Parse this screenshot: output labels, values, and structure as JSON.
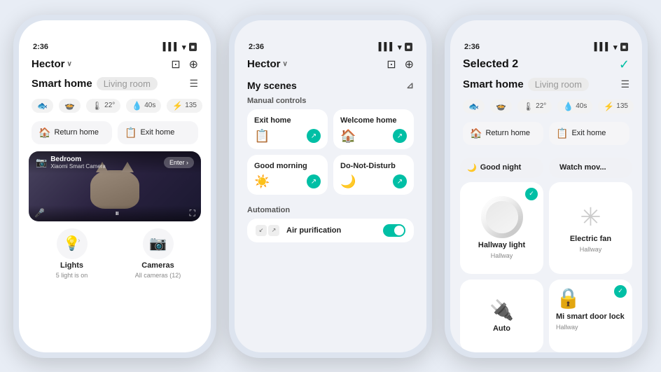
{
  "phones": [
    {
      "id": "phone1",
      "status_time": "2:36",
      "header": {
        "user": "Hector",
        "chevron": "∨"
      },
      "tabs": {
        "active": "Smart home",
        "inactive": "Living room"
      },
      "stats": [
        {
          "icon": "🐟",
          "value": ""
        },
        {
          "icon": "🍲",
          "value": ""
        },
        {
          "icon": "🌡",
          "value": "22°"
        },
        {
          "icon": "💧",
          "value": "40s"
        },
        {
          "icon": "⚡",
          "value": "135"
        }
      ],
      "scenes": [
        {
          "icon": "🏠",
          "label": "Return home"
        },
        {
          "icon": "📋",
          "label": "Exit home"
        }
      ],
      "camera": {
        "name": "Bedroom",
        "sub": "Xiaomi Smart Camera",
        "enter_label": "Enter ›"
      },
      "categories": [
        {
          "icon": "💡",
          "label": "Lights",
          "sub": "5 light is on"
        },
        {
          "icon": "📷",
          "label": "Cameras",
          "sub": "All cameras (12)"
        }
      ]
    },
    {
      "id": "phone2",
      "status_time": "2:36",
      "header": {
        "user": "Hector",
        "chevron": "∨"
      },
      "section_title": "My scenes",
      "manual_controls_label": "Manual controls",
      "scenes": [
        {
          "label": "Exit home",
          "icon": "📋"
        },
        {
          "label": "Welcome home",
          "icon": "🏠"
        },
        {
          "label": "Good morning",
          "icon": "☀️"
        },
        {
          "label": "Do-Not-Disturb",
          "icon": "🌙"
        }
      ],
      "automation_label": "Automation",
      "automation_items": [
        {
          "label": "Air purification",
          "icon": "🌿",
          "enabled": true
        }
      ]
    },
    {
      "id": "phone3",
      "status_time": "2:36",
      "selected_label": "Selected 2",
      "check": "✓",
      "tabs": {
        "active": "Smart home",
        "inactive": "Living room"
      },
      "stats": [
        {
          "icon": "🌡",
          "value": "22°"
        },
        {
          "icon": "💧",
          "value": "40s"
        },
        {
          "icon": "⚡",
          "value": "135"
        }
      ],
      "scenes": [
        {
          "icon": "🏠",
          "label": "Return home"
        },
        {
          "icon": "📋",
          "label": "Exit home"
        },
        {
          "icon": "🌙",
          "label": "Good night"
        },
        {
          "icon": "🎬",
          "label": "Watch mov..."
        }
      ],
      "devices": [
        {
          "icon": "💡",
          "name": "Hallway light",
          "sub": "Hallway",
          "selected": true,
          "type": "dial"
        },
        {
          "icon": "🌀",
          "name": "Electric fan",
          "sub": "Hallway",
          "selected": false,
          "type": "fan"
        },
        {
          "icon": "🔌",
          "name": "Auto",
          "sub": "",
          "selected": false,
          "type": "auto"
        },
        {
          "icon": "🔒",
          "name": "Mi smart door lock",
          "sub": "Hallway",
          "selected": true,
          "type": "lock"
        }
      ]
    }
  ]
}
